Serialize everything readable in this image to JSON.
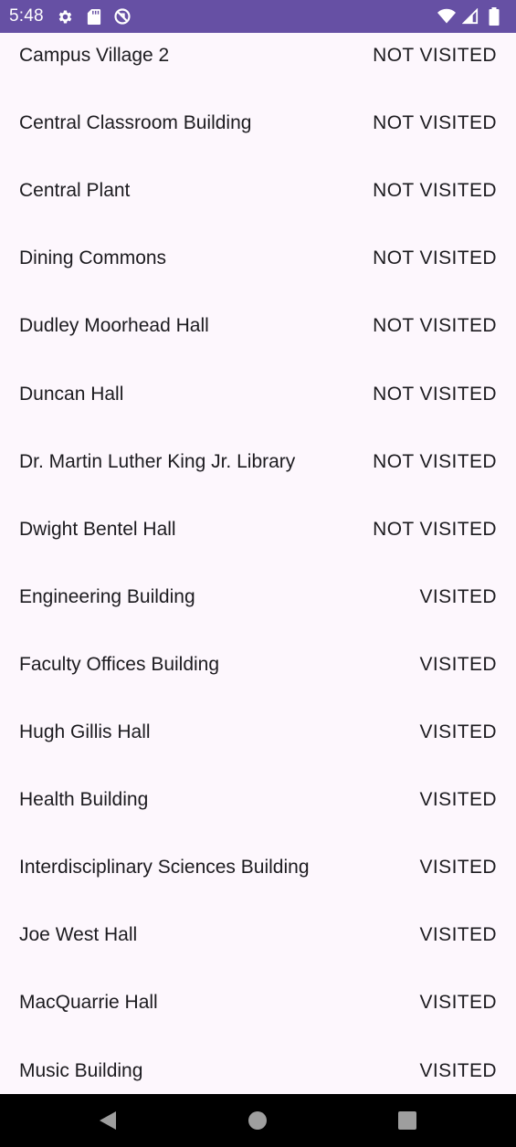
{
  "status_bar": {
    "time": "5:48",
    "color": "#6650a4",
    "left_icons": [
      "settings-icon",
      "sd-card-icon",
      "do-not-disturb-icon"
    ],
    "right_icons": [
      "wifi-icon",
      "cell-signal-icon",
      "battery-icon"
    ]
  },
  "buildings": [
    {
      "name": "Campus Village 2",
      "status": "NOT VISITED"
    },
    {
      "name": "Central Classroom Building",
      "status": "NOT VISITED"
    },
    {
      "name": "Central Plant",
      "status": "NOT VISITED"
    },
    {
      "name": "Dining Commons",
      "status": "NOT VISITED"
    },
    {
      "name": "Dudley Moorhead Hall",
      "status": "NOT VISITED"
    },
    {
      "name": "Duncan Hall",
      "status": "NOT VISITED"
    },
    {
      "name": "Dr. Martin Luther King Jr. Library",
      "status": "NOT VISITED"
    },
    {
      "name": "Dwight Bentel Hall",
      "status": "NOT VISITED"
    },
    {
      "name": "Engineering Building",
      "status": "VISITED"
    },
    {
      "name": "Faculty Offices Building",
      "status": "VISITED"
    },
    {
      "name": "Hugh Gillis Hall",
      "status": "VISITED"
    },
    {
      "name": "Health Building",
      "status": "VISITED"
    },
    {
      "name": "Interdisciplinary Sciences Building",
      "status": "VISITED"
    },
    {
      "name": "Joe West Hall",
      "status": "VISITED"
    },
    {
      "name": "MacQuarrie Hall",
      "status": "VISITED"
    },
    {
      "name": "Music Building",
      "status": "VISITED"
    }
  ],
  "nav_bar": {
    "buttons": [
      "back-icon",
      "home-icon",
      "recents-icon"
    ]
  }
}
